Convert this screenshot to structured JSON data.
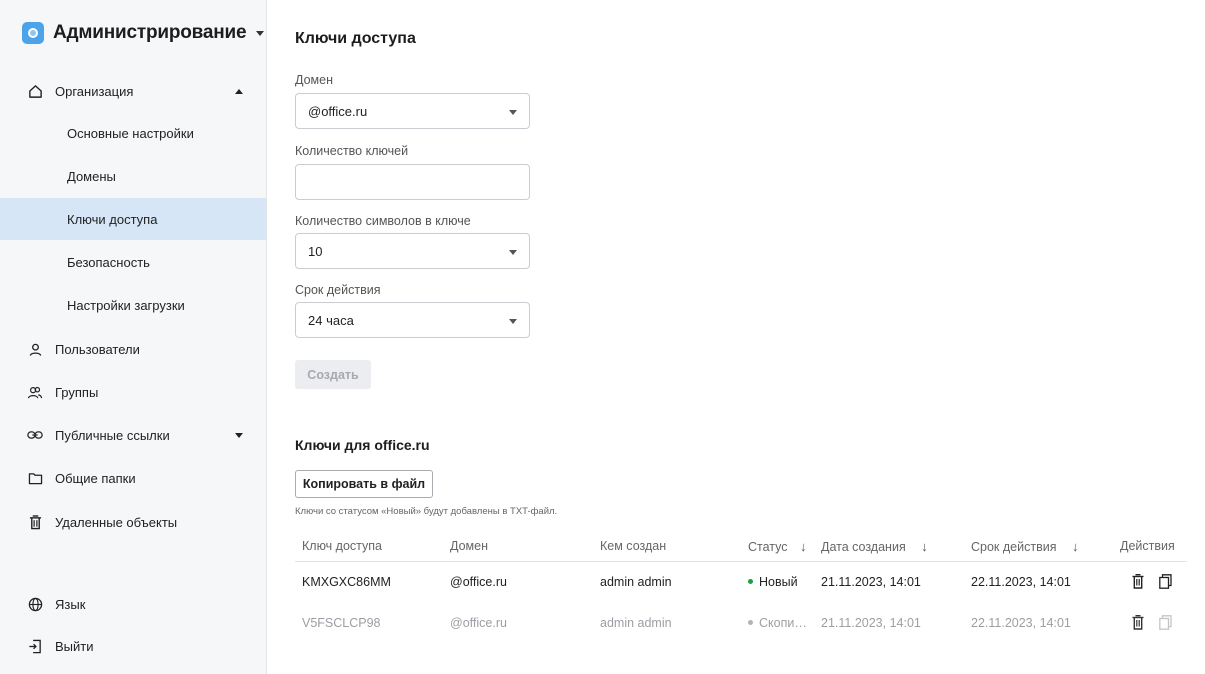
{
  "app": {
    "title": "Администрирование"
  },
  "sidebar": {
    "items": [
      {
        "label": "Организация"
      },
      {
        "label": "Основные настройки"
      },
      {
        "label": "Домены"
      },
      {
        "label": "Ключи доступа"
      },
      {
        "label": "Безопасность"
      },
      {
        "label": "Настройки загрузки"
      },
      {
        "label": "Пользователи"
      },
      {
        "label": "Группы"
      },
      {
        "label": "Публичные ссылки"
      },
      {
        "label": "Общие папки"
      },
      {
        "label": "Удаленные объекты"
      },
      {
        "label": "Язык"
      },
      {
        "label": "Выйти"
      }
    ],
    "active_index": 3
  },
  "form": {
    "title": "Ключи доступа",
    "domain_label": "Домен",
    "domain_value": "@office.ru",
    "count_label": "Количество ключей",
    "count_value": "",
    "length_label": "Количество символов в ключе",
    "length_value": "10",
    "validity_label": "Срок действия",
    "validity_value": "24 часа",
    "create_label": "Создать"
  },
  "keys": {
    "title": "Ключи для office.ru",
    "copy_label": "Копировать в файл",
    "hint": "Ключи со статусом «Новый» будут добавлены в TXT-файл.",
    "columns": {
      "key": "Ключ доступа",
      "domain": "Домен",
      "created_by": "Кем создан",
      "status": "Статус",
      "created_at": "Дата создания",
      "expires": "Срок действия",
      "actions": "Действия"
    },
    "rows": [
      {
        "key": "KMXGXC86MM",
        "domain": "@office.ru",
        "created_by": "admin admin",
        "status": "Новый",
        "created_at": "21.11.2023, 14:01",
        "expires": "22.11.2023, 14:01"
      },
      {
        "key": "V5FSCLCP98",
        "domain": "@office.ru",
        "created_by": "admin admin",
        "status": "Скопи…",
        "created_at": "21.11.2023, 14:01",
        "expires": "22.11.2023, 14:01"
      }
    ]
  },
  "colors": {
    "accent": "#4da3ea",
    "active_bg": "#d6e6f7",
    "status_new": "#1e9e45",
    "status_copied": "#b0b3b8"
  },
  "icons": {
    "logo": "disc-logo-icon",
    "organization": "home-icon",
    "users": "user-icon",
    "groups": "users-icon",
    "links": "link-icon",
    "shared": "folder-icon",
    "deleted": "trash-icon",
    "language": "globe-icon",
    "logout": "logout-icon",
    "delete": "trash-icon",
    "copy": "copy-icon"
  }
}
